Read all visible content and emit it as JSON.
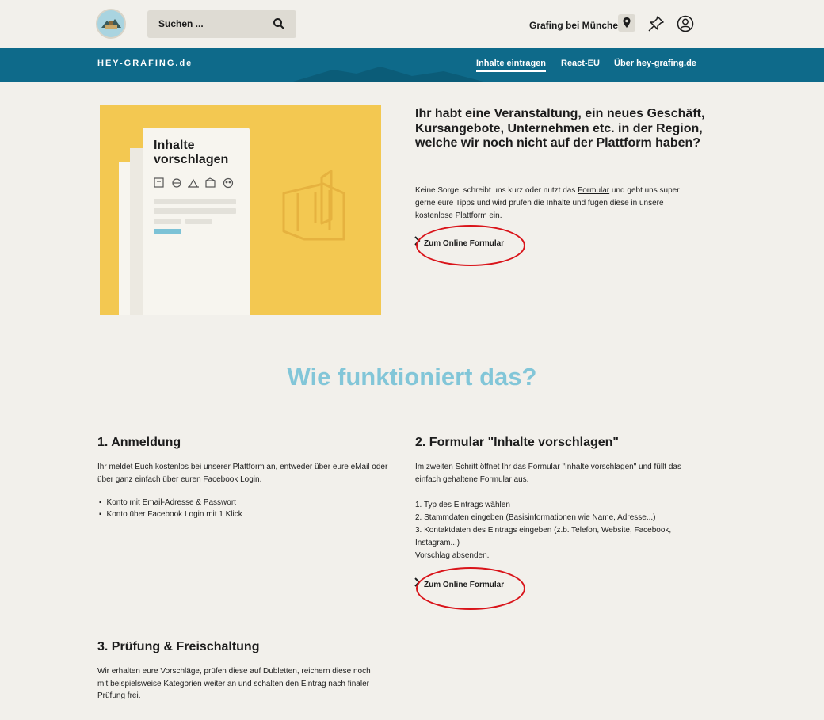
{
  "header": {
    "search_placeholder": "Suchen ...",
    "location": "Grafing bei München"
  },
  "nav": {
    "brand": "HEY-GRAFING.de",
    "items": [
      {
        "label": "Inhalte eintragen",
        "active": true
      },
      {
        "label": "React-EU",
        "active": false
      },
      {
        "label": "Über hey-grafing.de",
        "active": false
      }
    ]
  },
  "hero": {
    "card_title_line1": "Inhalte",
    "card_title_line2": "vorschlagen",
    "title": "Ihr habt eine Veranstaltung, ein neues Geschäft, Kursangebote, Unternehmen etc. in der Region, welche wir noch nicht auf der Plattform haben?",
    "body_part1": "Keine Sorge, schreibt uns kurz oder nutzt das ",
    "body_link": "Formular",
    "body_part2": " und gebt uns super gerne eure Tipps und wird prüfen die Inhalte und fügen diese in unsere kostenlose Plattform ein.",
    "cta": "Zum Online Formular"
  },
  "section_title": "Wie funktioniert das?",
  "steps": {
    "s1_title": "1. Anmeldung",
    "s1_text": "Ihr meldet Euch kostenlos bei unserer Plattform an, entweder über eure eMail oder über ganz einfach über euren Facebook Login.",
    "s1_bullets": [
      "Konto mit Email-Adresse & Passwort",
      "Konto über Facebook Login mit 1 Klick"
    ],
    "s2_title": "2. Formular \"Inhalte vorschlagen\"",
    "s2_text": "Im zweiten Schritt öffnet Ihr das Formular \"Inhalte vorschlagen\" und füllt das einfach gehaltene Formular aus.",
    "s2_list": [
      "1. Typ des Eintrags wählen",
      "2. Stammdaten eingeben (Basisinformationen wie Name, Adresse...)",
      "3. Kontaktdaten des Eintrags eingeben (z.b. Telefon, Website, Facebook, Instagram...)",
      "Vorschlag absenden."
    ],
    "s2_cta": "Zum Online Formular",
    "s3_title": "3. Prüfung & Freischaltung",
    "s3_text": "Wir erhalten eure Vorschläge, prüfen diese auf Dubletten, reichern diese noch mit beispielsweise Kategorien weiter an und schalten den Eintrag nach finaler Prüfung frei."
  },
  "colors": {
    "nav_bg": "#0e6a8a",
    "card_yellow": "#f3c851",
    "accent_teal": "#82c6d8",
    "annotation_red": "#d9141a"
  }
}
